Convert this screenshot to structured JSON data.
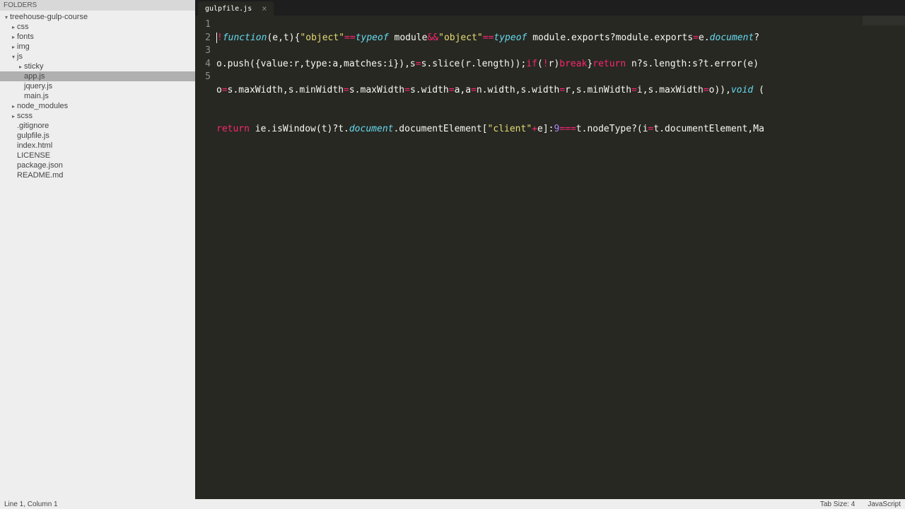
{
  "sidebar": {
    "header": "FOLDERS",
    "tree": [
      {
        "label": "treehouse-gulp-course",
        "indent": 0,
        "arrow": "▾",
        "selected": false
      },
      {
        "label": "css",
        "indent": 1,
        "arrow": "▸",
        "selected": false
      },
      {
        "label": "fonts",
        "indent": 1,
        "arrow": "▸",
        "selected": false
      },
      {
        "label": "img",
        "indent": 1,
        "arrow": "▸",
        "selected": false
      },
      {
        "label": "js",
        "indent": 1,
        "arrow": "▾",
        "selected": false
      },
      {
        "label": "sticky",
        "indent": 2,
        "arrow": "▸",
        "selected": false
      },
      {
        "label": "app.js",
        "indent": 2,
        "arrow": "",
        "selected": true
      },
      {
        "label": "jquery.js",
        "indent": 2,
        "arrow": "",
        "selected": false
      },
      {
        "label": "main.js",
        "indent": 2,
        "arrow": "",
        "selected": false
      },
      {
        "label": "node_modules",
        "indent": 1,
        "arrow": "▸",
        "selected": false
      },
      {
        "label": "scss",
        "indent": 1,
        "arrow": "▸",
        "selected": false
      },
      {
        "label": ".gitignore",
        "indent": 1,
        "arrow": "",
        "selected": false
      },
      {
        "label": "gulpfile.js",
        "indent": 1,
        "arrow": "",
        "selected": false
      },
      {
        "label": "index.html",
        "indent": 1,
        "arrow": "",
        "selected": false
      },
      {
        "label": "LICENSE",
        "indent": 1,
        "arrow": "",
        "selected": false
      },
      {
        "label": "package.json",
        "indent": 1,
        "arrow": "",
        "selected": false
      },
      {
        "label": "README.md",
        "indent": 1,
        "arrow": "",
        "selected": false
      }
    ]
  },
  "tabs": [
    {
      "label": "gulpfile.js",
      "active": true
    }
  ],
  "code": {
    "line1": {
      "bang": "!",
      "function": "function",
      "params": "(e,t){",
      "str1": "\"object\"",
      "eq1": "==",
      "typeof1": "typeof",
      "module1": " module",
      "and": "&&",
      "str2": "\"object\"",
      "eq2": "==",
      "typeof2": "typeof",
      "module2": " module.exports?module.exports",
      "assign1": "=",
      "tail1": "e.",
      "doc1": "document",
      "q1": "?"
    },
    "line2": {
      "pre": "o.push({value:r,type:a,matches:i}),s",
      "assign1": "=",
      "mid1": "s.slice(r.length));",
      "if": "if",
      "paren1": "(",
      "not": "!",
      "r": "r)",
      "break": "break",
      "brace": "}",
      "return": "return",
      "tail": " n?s.length:s?t.error(e)"
    },
    "line3": {
      "pre": "o",
      "a1": "=",
      "p1": "s.maxWidth,s.minWidth",
      "a2": "=",
      "p2": "s.maxWidth",
      "a3": "=",
      "p3": "s.width",
      "a4": "=",
      "p4": "a,a",
      "a5": "=",
      "p5": "n.width,s.width",
      "a6": "=",
      "p6": "r,s.minWidth",
      "a7": "=",
      "p7": "i,s.maxWidth",
      "a8": "=",
      "p8": "o)),",
      "void": "void",
      "tail": " ("
    },
    "line4": "",
    "line5": {
      "return": "return",
      "pre": " ie.isWindow(t)?t.",
      "doc": "document",
      "mid": ".documentElement[",
      "str": "\"client\"",
      "plus": "+",
      "e": "e]:",
      "nine": "9",
      "eqeq": "===",
      "tail": "t.nodeType?(i",
      "a1": "=",
      "tail2": "t.documentElement,Ma"
    },
    "gutter": [
      "1",
      "2",
      "3",
      "4",
      "5"
    ]
  },
  "status": {
    "left": "Line 1, Column 1",
    "tabsize": "Tab Size: 4",
    "language": "JavaScript"
  }
}
